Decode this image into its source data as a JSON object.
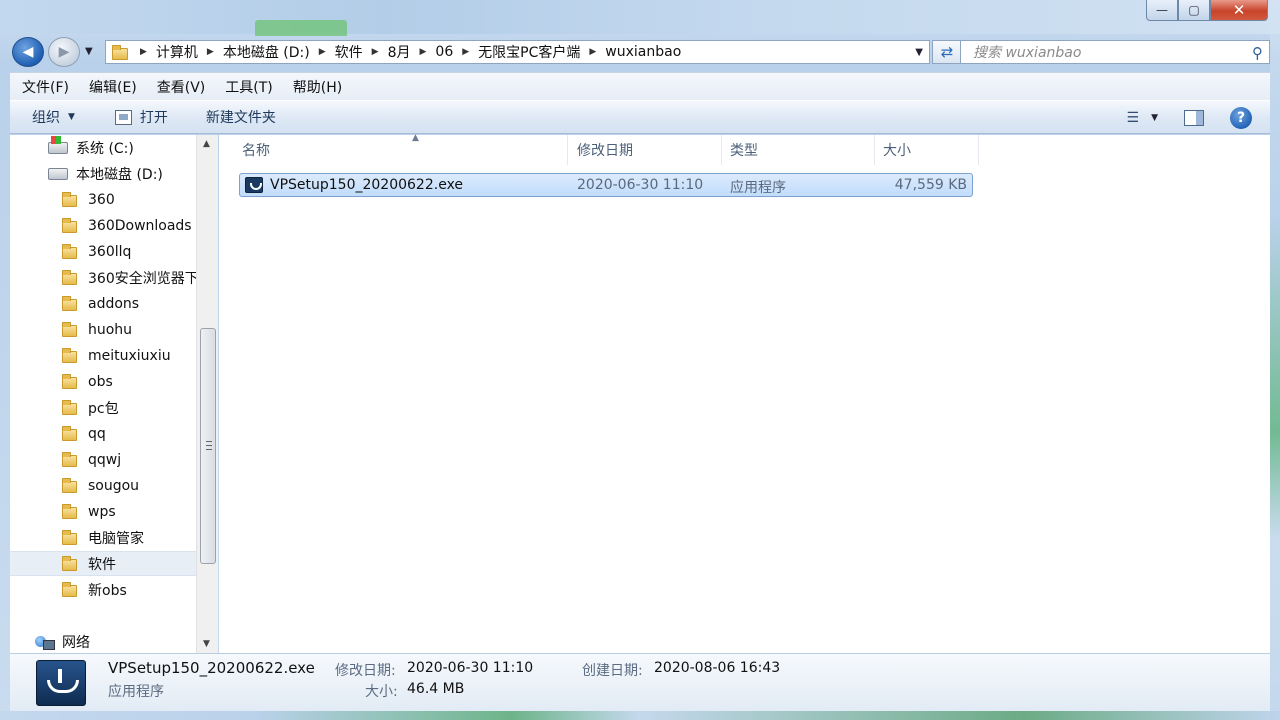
{
  "window": {
    "minimize_glyph": "—",
    "maximize_glyph": "▢",
    "close_glyph": "✕"
  },
  "address": {
    "crumbs": [
      "计算机",
      "本地磁盘 (D:)",
      "软件",
      "8月",
      "06",
      "无限宝PC客户端",
      "wuxianbao"
    ],
    "search_placeholder": "搜索 wuxianbao"
  },
  "menu": [
    "文件(F)",
    "编辑(E)",
    "查看(V)",
    "工具(T)",
    "帮助(H)"
  ],
  "toolbar": {
    "organize": "组织",
    "open": "打开",
    "new_folder": "新建文件夹"
  },
  "nav_tree": [
    {
      "label": "系统 (C:)",
      "kind": "drive-sys"
    },
    {
      "label": "本地磁盘 (D:)",
      "kind": "drive"
    },
    {
      "label": "360",
      "kind": "folder"
    },
    {
      "label": "360Downloads",
      "kind": "folder"
    },
    {
      "label": "360llq",
      "kind": "folder"
    },
    {
      "label": "360安全浏览器下",
      "kind": "folder"
    },
    {
      "label": "addons",
      "kind": "folder"
    },
    {
      "label": "huohu",
      "kind": "folder"
    },
    {
      "label": "meituxiuxiu",
      "kind": "folder"
    },
    {
      "label": "obs",
      "kind": "folder"
    },
    {
      "label": "pc包",
      "kind": "folder"
    },
    {
      "label": "qq",
      "kind": "folder"
    },
    {
      "label": "qqwj",
      "kind": "folder"
    },
    {
      "label": "sougou",
      "kind": "folder"
    },
    {
      "label": "wps",
      "kind": "folder"
    },
    {
      "label": "电脑管家",
      "kind": "folder"
    },
    {
      "label": "软件",
      "kind": "folder",
      "selected": true
    },
    {
      "label": "新obs",
      "kind": "folder"
    },
    {
      "label": "网络",
      "kind": "network"
    }
  ],
  "columns": {
    "name": "名称",
    "modified": "修改日期",
    "type": "类型",
    "size": "大小"
  },
  "files": [
    {
      "name": "VPSetup150_20200622.exe",
      "modified": "2020-06-30 11:10",
      "type": "应用程序",
      "size": "47,559 KB"
    }
  ],
  "details": {
    "name": "VPSetup150_20200622.exe",
    "type": "应用程序",
    "modified_label": "修改日期:",
    "modified_value": "2020-06-30 11:10",
    "size_label": "大小:",
    "size_value": "46.4 MB",
    "created_label": "创建日期:",
    "created_value": "2020-08-06 16:43"
  }
}
